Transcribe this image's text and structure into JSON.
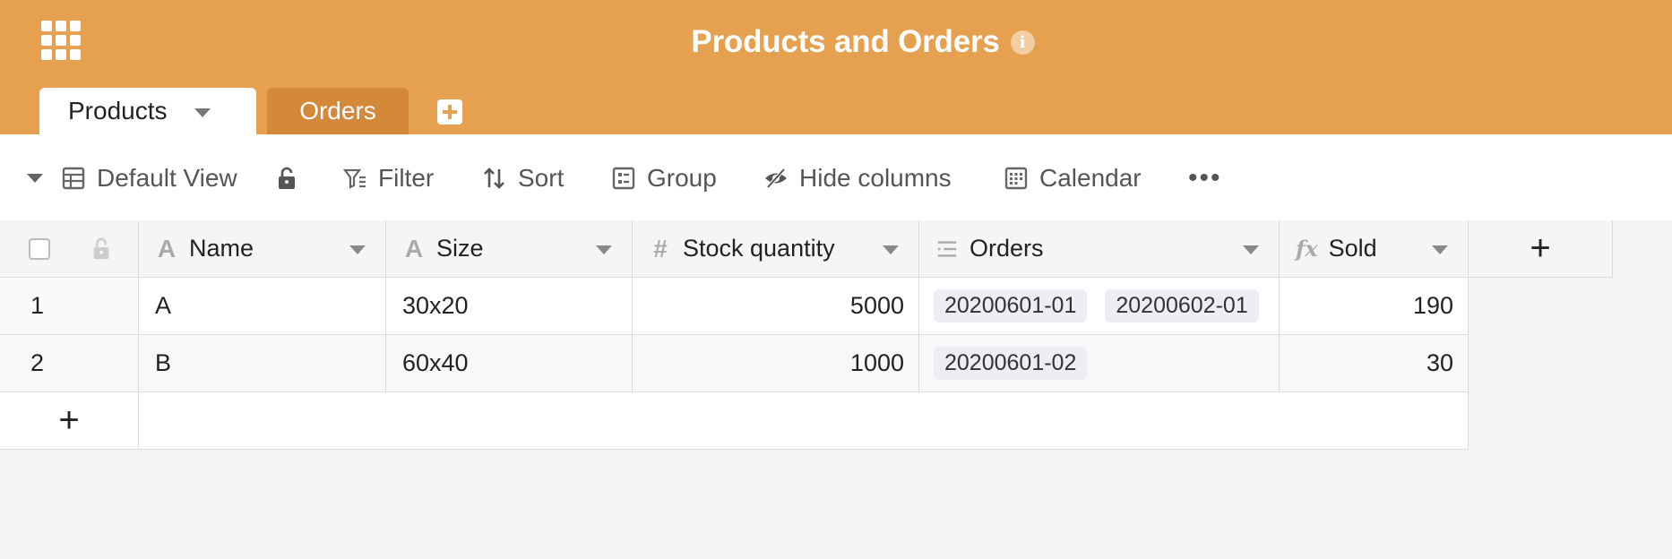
{
  "header": {
    "title": "Products and Orders",
    "bg_color": "#e5a150",
    "info_icon_glyph": "i",
    "tabs": [
      {
        "label": "Products",
        "active": true
      },
      {
        "label": "Orders",
        "active": false
      }
    ]
  },
  "toolbar": {
    "view_label": "Default View",
    "filter_label": "Filter",
    "sort_label": "Sort",
    "group_label": "Group",
    "hide_label": "Hide columns",
    "calendar_label": "Calendar",
    "more_label": "•••"
  },
  "table": {
    "columns": [
      {
        "name": "Name",
        "type_icon": "text-icon"
      },
      {
        "name": "Size",
        "type_icon": "text-icon"
      },
      {
        "name": "Stock quantity",
        "type_icon": "number-icon"
      },
      {
        "name": "Orders",
        "type_icon": "link-icon"
      },
      {
        "name": "Sold",
        "type_icon": "formula-icon"
      }
    ],
    "add_column_label": "+",
    "add_row_label": "+",
    "rows": [
      {
        "index": "1",
        "name": "A",
        "size": "30x20",
        "stock": "5000",
        "orders": [
          "20200601-01",
          "20200602-01"
        ],
        "sold": "190"
      },
      {
        "index": "2",
        "name": "B",
        "size": "60x40",
        "stock": "1000",
        "orders": [
          "20200601-02"
        ],
        "sold": "30"
      }
    ]
  },
  "icons": {
    "text_type": "A",
    "number_type": "#",
    "formula_type": "fx"
  }
}
